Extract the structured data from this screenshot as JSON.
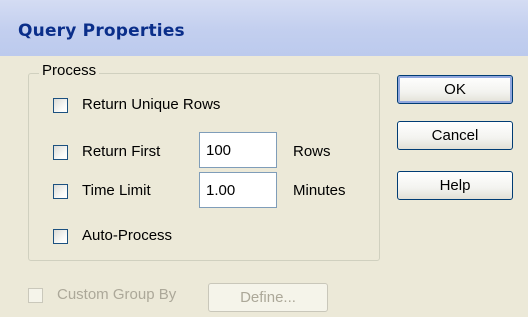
{
  "dialog": {
    "title": "Query Properties"
  },
  "process": {
    "label": "Process",
    "return_unique_rows": {
      "label": "Return Unique Rows",
      "checked": false
    },
    "return_first": {
      "label": "Return First",
      "value": "100",
      "unit": "Rows",
      "checked": false
    },
    "time_limit": {
      "label": "Time Limit",
      "value": "1.00",
      "unit": "Minutes",
      "checked": false
    },
    "auto_process": {
      "label": "Auto-Process",
      "checked": false
    }
  },
  "custom_group_by": {
    "label": "Custom Group By",
    "checked": false,
    "enabled": false
  },
  "buttons": {
    "ok": "OK",
    "cancel": "Cancel",
    "help": "Help",
    "define": "Define..."
  }
}
